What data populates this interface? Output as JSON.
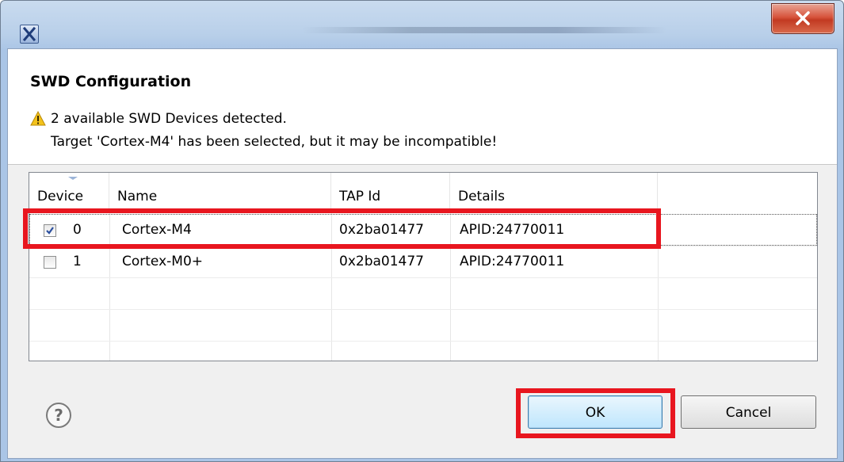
{
  "dialog": {
    "title": "SWD Configuration",
    "message_line1": "2 available SWD Devices detected.",
    "message_line2": "Target 'Cortex-M4' has been selected, but it may be incompatible!"
  },
  "icons": {
    "app": "eclipse-x-icon",
    "close": "close-icon",
    "warning": "warning-icon",
    "help": "help-icon"
  },
  "table": {
    "columns": [
      "Device",
      "Name",
      "TAP Id",
      "Details"
    ],
    "rows": [
      {
        "checked": true,
        "device": "0",
        "name": "Cortex-M4",
        "tap_id": "0x2ba01477",
        "details": "APID:24770011"
      },
      {
        "checked": false,
        "device": "1",
        "name": "Cortex-M0+",
        "tap_id": "0x2ba01477",
        "details": "APID:24770011"
      }
    ]
  },
  "buttons": {
    "ok": "OK",
    "cancel": "Cancel"
  },
  "colors": {
    "highlight": "#e8161f",
    "warning": "#f3c21b"
  }
}
